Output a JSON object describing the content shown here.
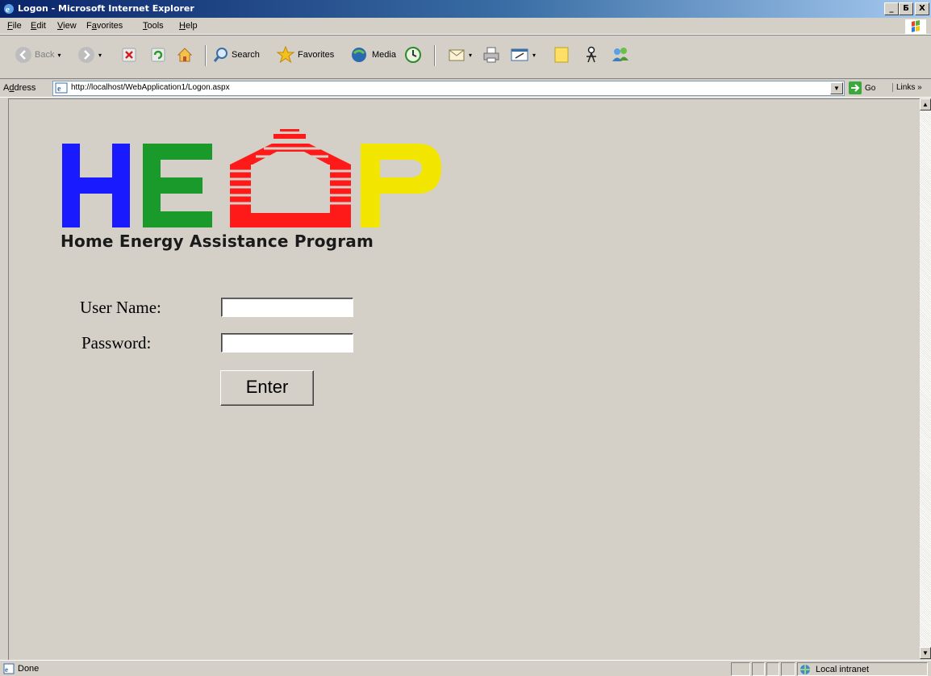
{
  "window": {
    "title": "Logon - Microsoft Internet Explorer",
    "buttons": [
      "_",
      "Б",
      "X"
    ]
  },
  "menu": {
    "items": [
      {
        "label": "File",
        "accel": "F",
        "rest": "ile"
      },
      {
        "label": "Edit",
        "accel": "E",
        "rest": "dit"
      },
      {
        "label": "View",
        "accel": "V",
        "rest": "iew"
      },
      {
        "label": "Favorites",
        "pre": "F",
        "accel": "a",
        "rest": "vorites"
      },
      {
        "label": "Tools",
        "accel": "T",
        "rest": "ools"
      },
      {
        "label": "Help",
        "accel": "H",
        "rest": "elp"
      }
    ]
  },
  "toolbar": {
    "back_label": "Back",
    "search_label": "Search",
    "favorites_label": "Favorites",
    "media_label": "Media"
  },
  "address": {
    "label_pre": "A",
    "label_accel": "d",
    "label_rest": "dress",
    "url": "http://localhost/WebApplication1/Logon.aspx",
    "go_label": "Go",
    "links_label": "Links »"
  },
  "page": {
    "logo_text": "HEAP",
    "tagline": "Home Energy Assistance Program",
    "username_label": "User Name:",
    "password_label": "Password:",
    "username_value": "",
    "password_value": "",
    "enter_label": "Enter"
  },
  "status": {
    "text": "Done",
    "zone": "Local intranet"
  },
  "colors": {
    "logo_h": "#1a1aff",
    "logo_e": "#1a9a2a",
    "logo_a": "#ff1a1a",
    "logo_p": "#f2e600"
  }
}
